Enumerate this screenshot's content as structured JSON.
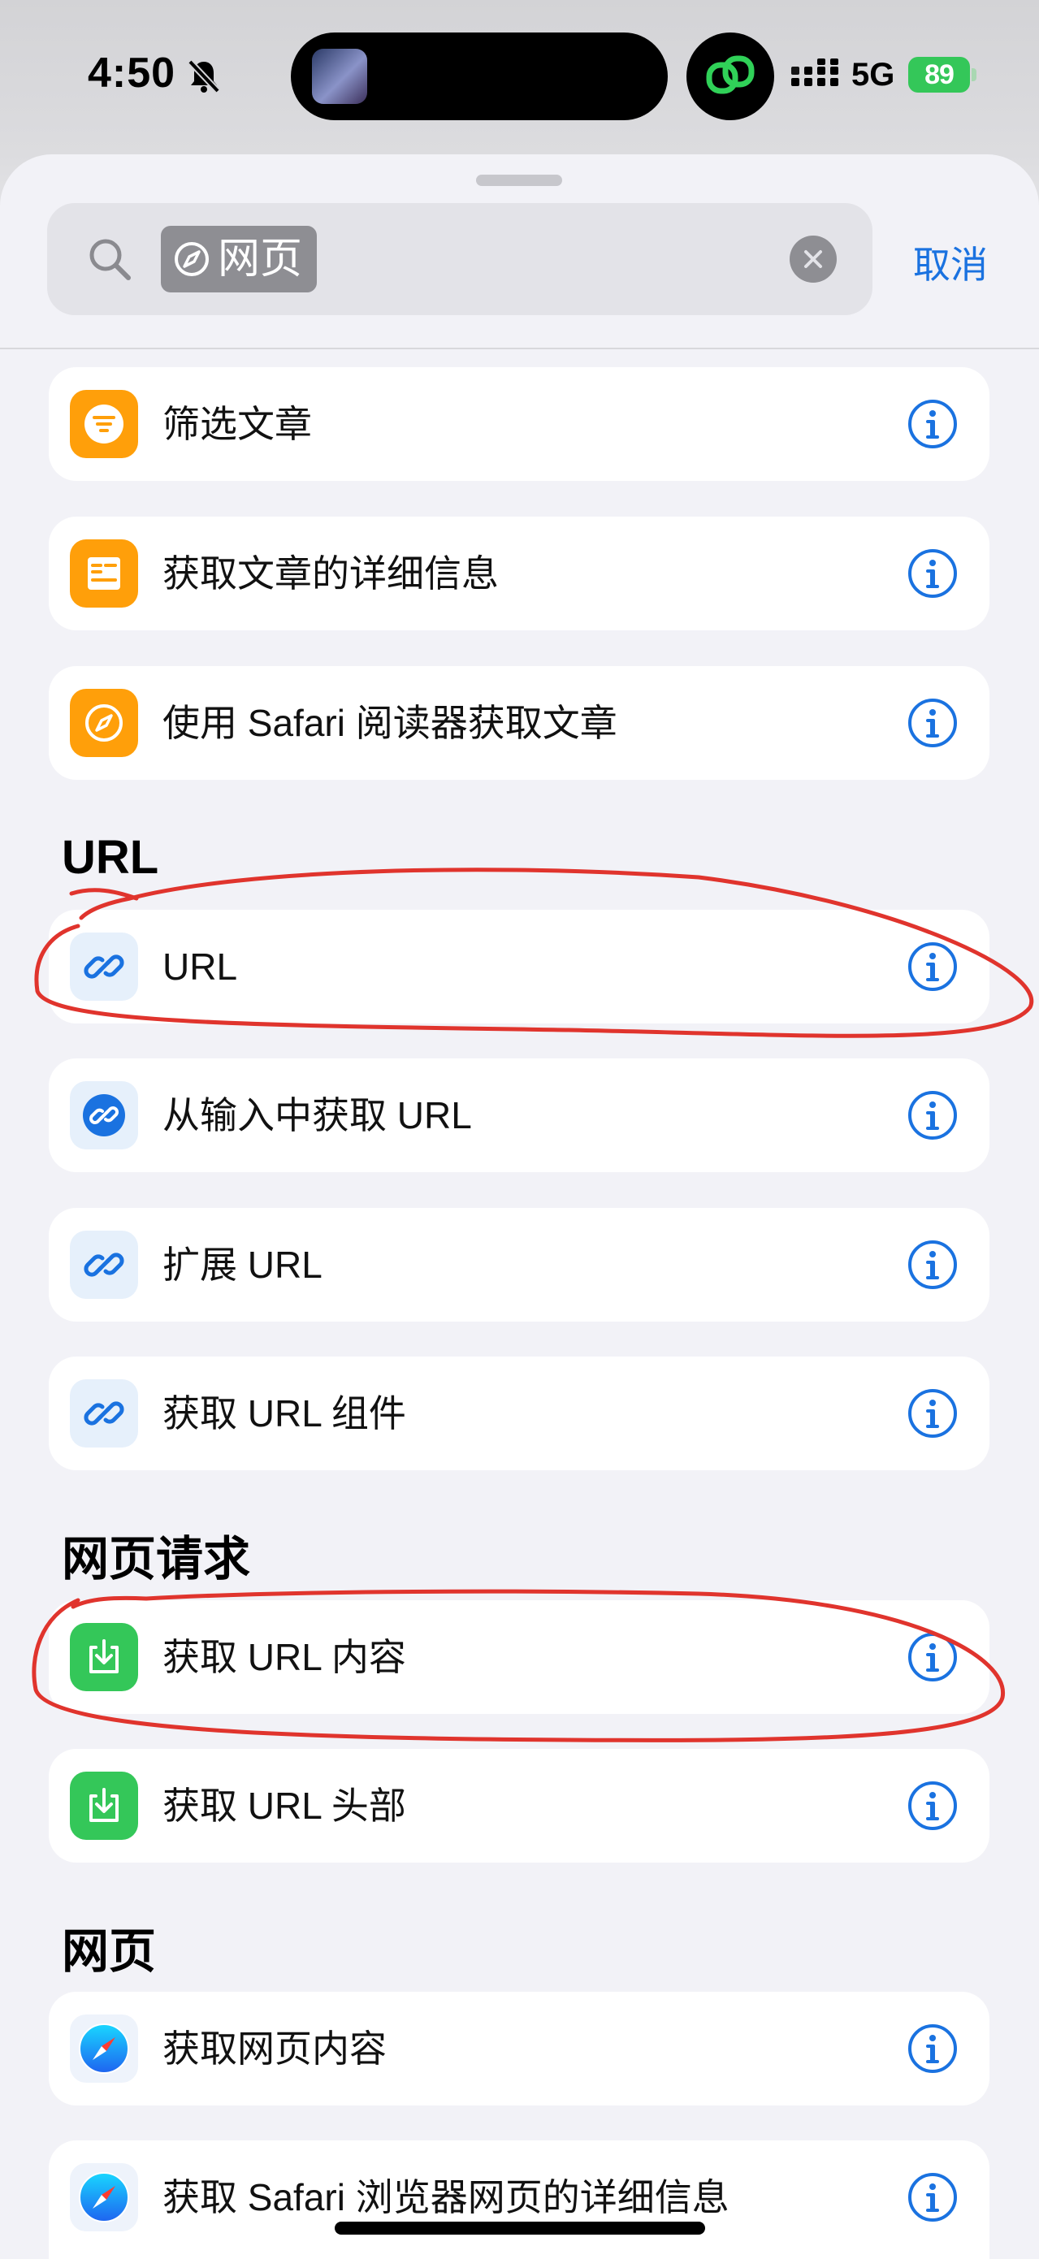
{
  "status_bar": {
    "time": "4:50",
    "network": "5G",
    "battery": "89"
  },
  "search": {
    "token": "网页",
    "cancel_label": "取消"
  },
  "cards": [
    {
      "id": "filter-articles",
      "label": "筛选文章",
      "icon": "filter-list-icon"
    },
    {
      "id": "article-details",
      "label": "获取文章的详细信息",
      "icon": "article-icon"
    },
    {
      "id": "safari-reader",
      "label": "使用 Safari 阅读器获取文章",
      "icon": "compass-icon"
    },
    {
      "id": "url",
      "label": "URL",
      "icon": "link-icon"
    },
    {
      "id": "get-urls-from-input",
      "label": "从输入中获取 URL",
      "icon": "link-icon"
    },
    {
      "id": "expand-url",
      "label": "扩展 URL",
      "icon": "link-icon"
    },
    {
      "id": "get-url-components",
      "label": "获取 URL 组件",
      "icon": "link-icon"
    },
    {
      "id": "get-url-contents",
      "label": "获取 URL 内容",
      "icon": "download-icon"
    },
    {
      "id": "get-url-headers",
      "label": "获取 URL 头部",
      "icon": "download-icon"
    },
    {
      "id": "get-webpage-contents",
      "label": "获取网页内容",
      "icon": "safari-icon"
    },
    {
      "id": "safari-webpage-details",
      "label": "获取 Safari 浏览器网页的详细信息",
      "icon": "safari-icon"
    }
  ],
  "sections": {
    "url": "URL",
    "web_requests": "网页请求",
    "web_pages": "网页"
  },
  "colors": {
    "accent": "#1a72e0",
    "orange": "#ff9f0a",
    "green": "#34c759",
    "annotation": "#e0342d"
  }
}
